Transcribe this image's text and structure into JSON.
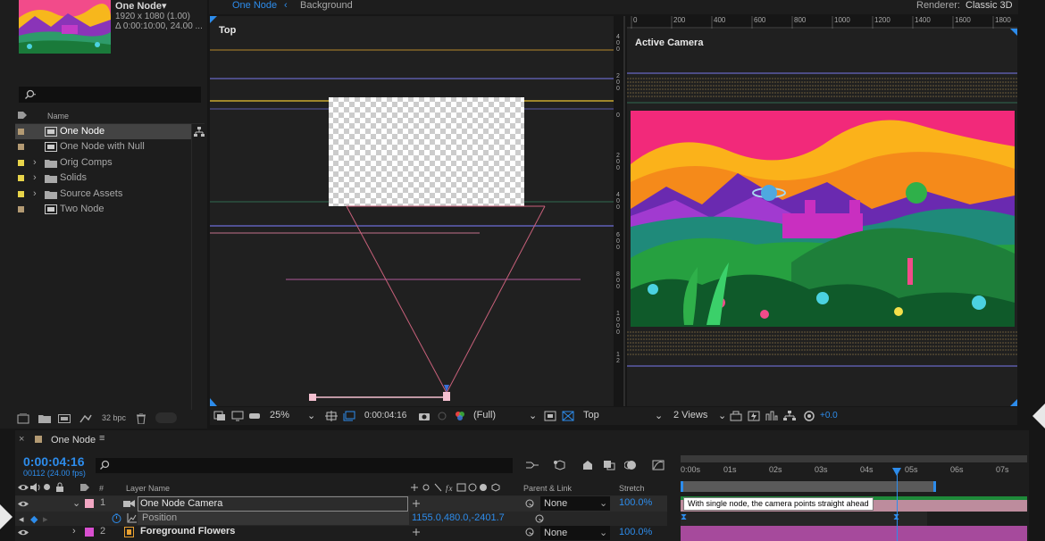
{
  "project": {
    "comp_name": "One Node",
    "comp_info_dims": "1920 x 1080 (1.00)",
    "comp_info_dur": "Δ 0:00:10:00, 24.00 ...",
    "name_header": "Name",
    "items": [
      {
        "name": "One Node",
        "type": "comp",
        "label_color": "#b39a73"
      },
      {
        "name": "One Node with Null",
        "type": "comp",
        "label_color": "#b39a73"
      },
      {
        "name": "Orig Comps",
        "type": "folder",
        "label_color": "#e8d44a"
      },
      {
        "name": "Solids",
        "type": "folder",
        "label_color": "#e8d44a"
      },
      {
        "name": "Source Assets",
        "type": "folder",
        "label_color": "#e8d44a"
      },
      {
        "name": "Two Node",
        "type": "comp",
        "label_color": "#b39a73"
      }
    ],
    "bpc": "32 bpc"
  },
  "viewer": {
    "tab_active": "One Node",
    "tab_breadcrumb": "Background",
    "renderer_label": "Renderer:",
    "renderer_value": "Classic 3D",
    "left_view_label": "Top",
    "right_view_label": "Active Camera",
    "ruler_ticks": [
      "0",
      "200",
      "400",
      "600",
      "800",
      "1000",
      "1200",
      "1400",
      "1600",
      "1800"
    ],
    "vruler_labels": [
      "4\n0\n0",
      "2\n0\n0",
      "0",
      "2\n0\n0",
      "4\n0\n0",
      "6\n0\n0",
      "8\n0\n0",
      "1\n0\n0\n0",
      "1\n2"
    ],
    "zoom": "25%",
    "timecode": "0:00:04:16",
    "resolution": "(Full)",
    "view": "Top",
    "views": "2 Views",
    "exposure": "+0.0"
  },
  "timeline": {
    "comp_tab": "One Node",
    "current_time": "0:00:04:16",
    "frame_info": "00112 (24.00 fps)",
    "col_num": "#",
    "col_layer_name": "Layer Name",
    "col_parent": "Parent & Link",
    "col_stretch": "Stretch",
    "ruler_labels": [
      "0:00s",
      "01s",
      "02s",
      "03s",
      "04s",
      "05s",
      "06s",
      "07s"
    ],
    "layers": [
      {
        "num": "1",
        "name": "One Node Camera",
        "parent": "None",
        "stretch": "100.0%",
        "label_color": "#f2a7c3",
        "selected": true
      },
      {
        "num": "2",
        "name": "Foreground Flowers",
        "parent": "None",
        "stretch": "100.0%",
        "label_color": "#d84fd0",
        "selected": false
      }
    ],
    "property": {
      "name": "Position",
      "value": "1155.0,480.0,-2401.7"
    },
    "comment": "With single node, the camera points straight ahead"
  }
}
